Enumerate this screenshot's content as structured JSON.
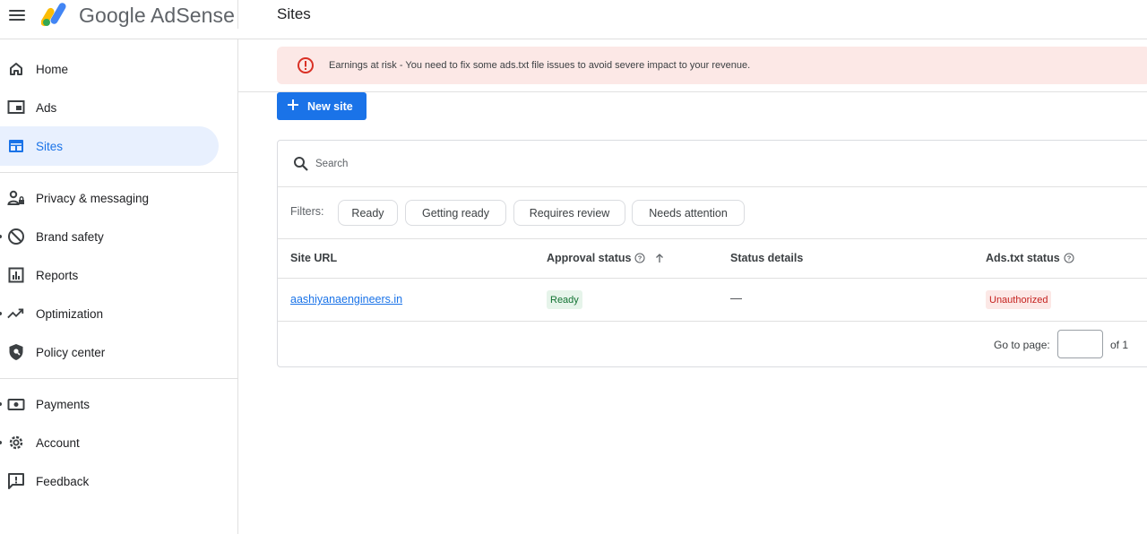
{
  "app": {
    "brand": "Google AdSense",
    "page_title": "Sites"
  },
  "sidebar": {
    "items": [
      {
        "label": "Home",
        "icon": "home-icon"
      },
      {
        "label": "Ads",
        "icon": "ads-icon"
      },
      {
        "label": "Sites",
        "icon": "sites-icon",
        "active": true
      },
      {
        "label": "Privacy & messaging",
        "icon": "privacy-icon"
      },
      {
        "label": "Brand safety",
        "icon": "block-icon"
      },
      {
        "label": "Reports",
        "icon": "reports-icon"
      },
      {
        "label": "Optimization",
        "icon": "trending-up-icon"
      },
      {
        "label": "Policy center",
        "icon": "shield-icon"
      },
      {
        "label": "Payments",
        "icon": "payments-icon"
      },
      {
        "label": "Account",
        "icon": "gear-icon"
      },
      {
        "label": "Feedback",
        "icon": "feedback-icon"
      }
    ]
  },
  "alert": {
    "text": "Earnings at risk - You need to fix some ads.txt file issues to avoid severe impact to your revenue.",
    "icon": "error-icon"
  },
  "toolbar": {
    "new_site_label": "New site"
  },
  "search": {
    "placeholder": "Search"
  },
  "filters": {
    "label": "Filters:",
    "chips": [
      "Ready",
      "Getting ready",
      "Requires review",
      "Needs attention"
    ]
  },
  "table": {
    "columns": [
      "Site URL",
      "Approval status",
      "Status details",
      "Ads.txt status"
    ],
    "rows": [
      {
        "site_url": "aashiyanaengineers.in",
        "approval_status": "Ready",
        "status_details": "—",
        "ads_txt_status": "Unauthorized"
      }
    ]
  },
  "pagination": {
    "go_to_label": "Go to page:",
    "current": "",
    "of_label": "of 1"
  },
  "colors": {
    "accent": "#1a73e8",
    "alert_bg": "#fce8e6",
    "ready_bg": "#e6f4ea",
    "ready_fg": "#137333",
    "unauth_fg": "#c5221f"
  }
}
